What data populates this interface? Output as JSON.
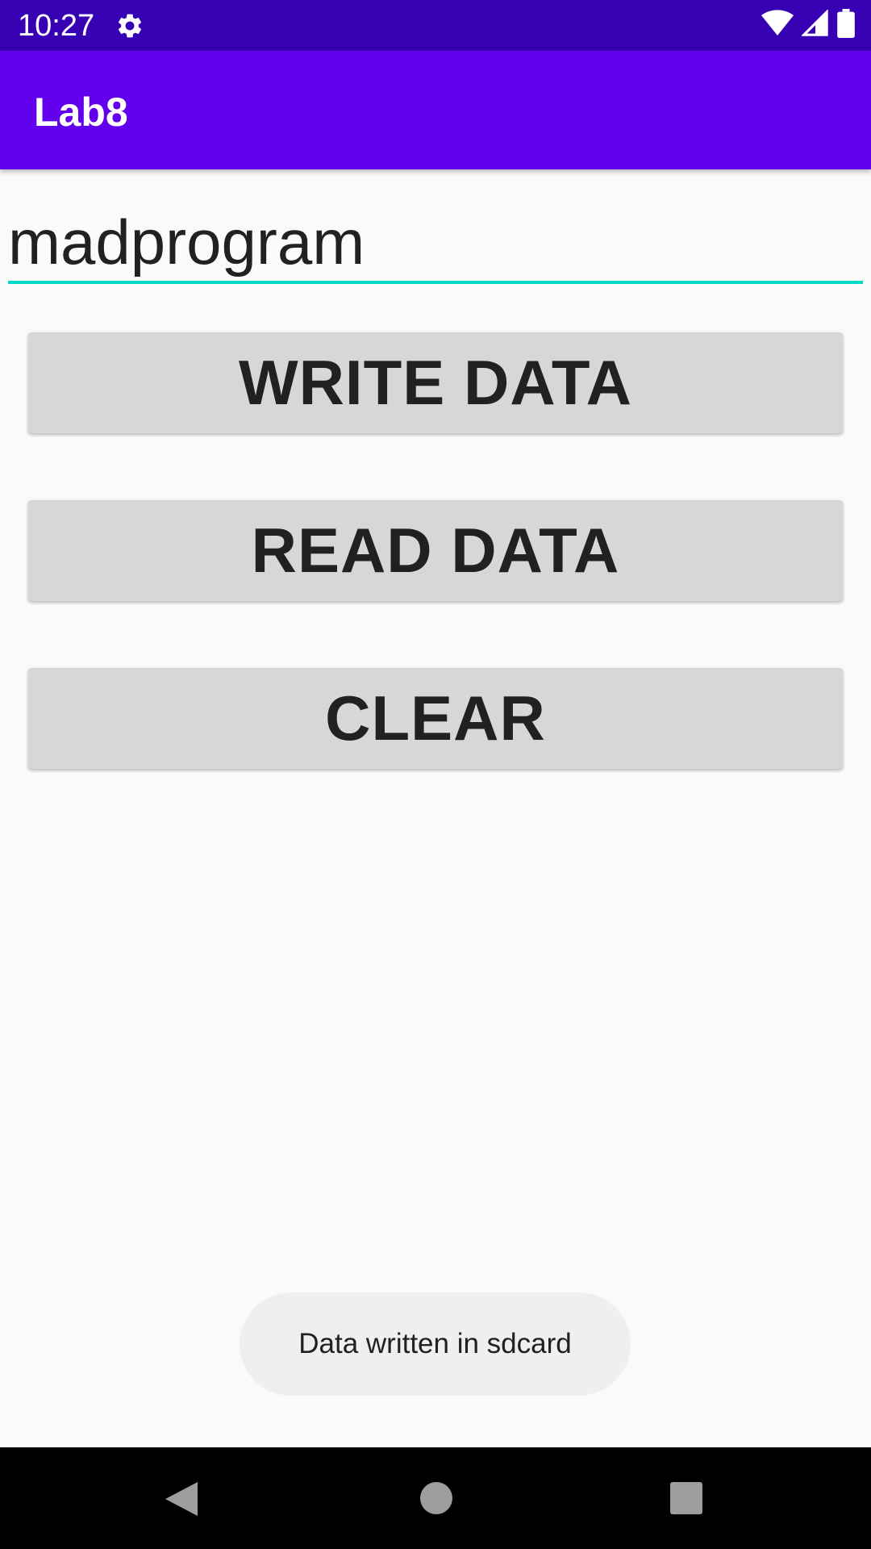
{
  "status_bar": {
    "time": "10:27",
    "icons": [
      "gear-icon",
      "wifi-icon",
      "signal-icon",
      "battery-icon"
    ],
    "color": "#3700b3"
  },
  "app_bar": {
    "title": "Lab8",
    "color": "#6200ee"
  },
  "input": {
    "value": "madprogram",
    "underline_color": "#03dac5"
  },
  "buttons": {
    "write_label": "WRITE DATA",
    "read_label": "READ DATA",
    "clear_label": "CLEAR"
  },
  "toast": {
    "message": "Data written in sdcard"
  },
  "nav_bar": {
    "icons": [
      "back-icon",
      "home-icon",
      "recents-icon"
    ]
  }
}
